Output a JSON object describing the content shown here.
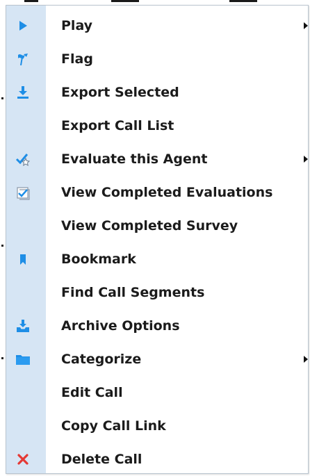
{
  "menu": {
    "items": [
      {
        "label": "Play",
        "icon": "play-icon",
        "submenu": true
      },
      {
        "label": "Flag",
        "icon": "flag-icon",
        "submenu": false
      },
      {
        "label": "Export Selected",
        "icon": "download-icon",
        "submenu": false
      },
      {
        "label": "Export Call List",
        "icon": "",
        "submenu": false
      },
      {
        "label": "Evaluate this Agent",
        "icon": "evaluate-star-icon",
        "submenu": true
      },
      {
        "label": "View Completed Evaluations",
        "icon": "checklist-icon",
        "submenu": false
      },
      {
        "label": "View Completed Survey",
        "icon": "",
        "submenu": false
      },
      {
        "label": "Bookmark",
        "icon": "bookmark-icon",
        "submenu": false
      },
      {
        "label": "Find Call Segments",
        "icon": "",
        "submenu": false
      },
      {
        "label": "Archive Options",
        "icon": "archive-tray-icon",
        "submenu": false
      },
      {
        "label": "Categorize",
        "icon": "folder-icon",
        "submenu": true
      },
      {
        "label": "Edit Call",
        "icon": "",
        "submenu": false
      },
      {
        "label": "Copy Call Link",
        "icon": "",
        "submenu": false
      },
      {
        "label": "Delete Call",
        "icon": "close-x-icon",
        "submenu": false
      }
    ]
  },
  "colors": {
    "gutter": "#d6e5f4",
    "icon_blue": "#1e8ee6",
    "delete_red": "#e53935",
    "text": "#1b1b1b"
  }
}
